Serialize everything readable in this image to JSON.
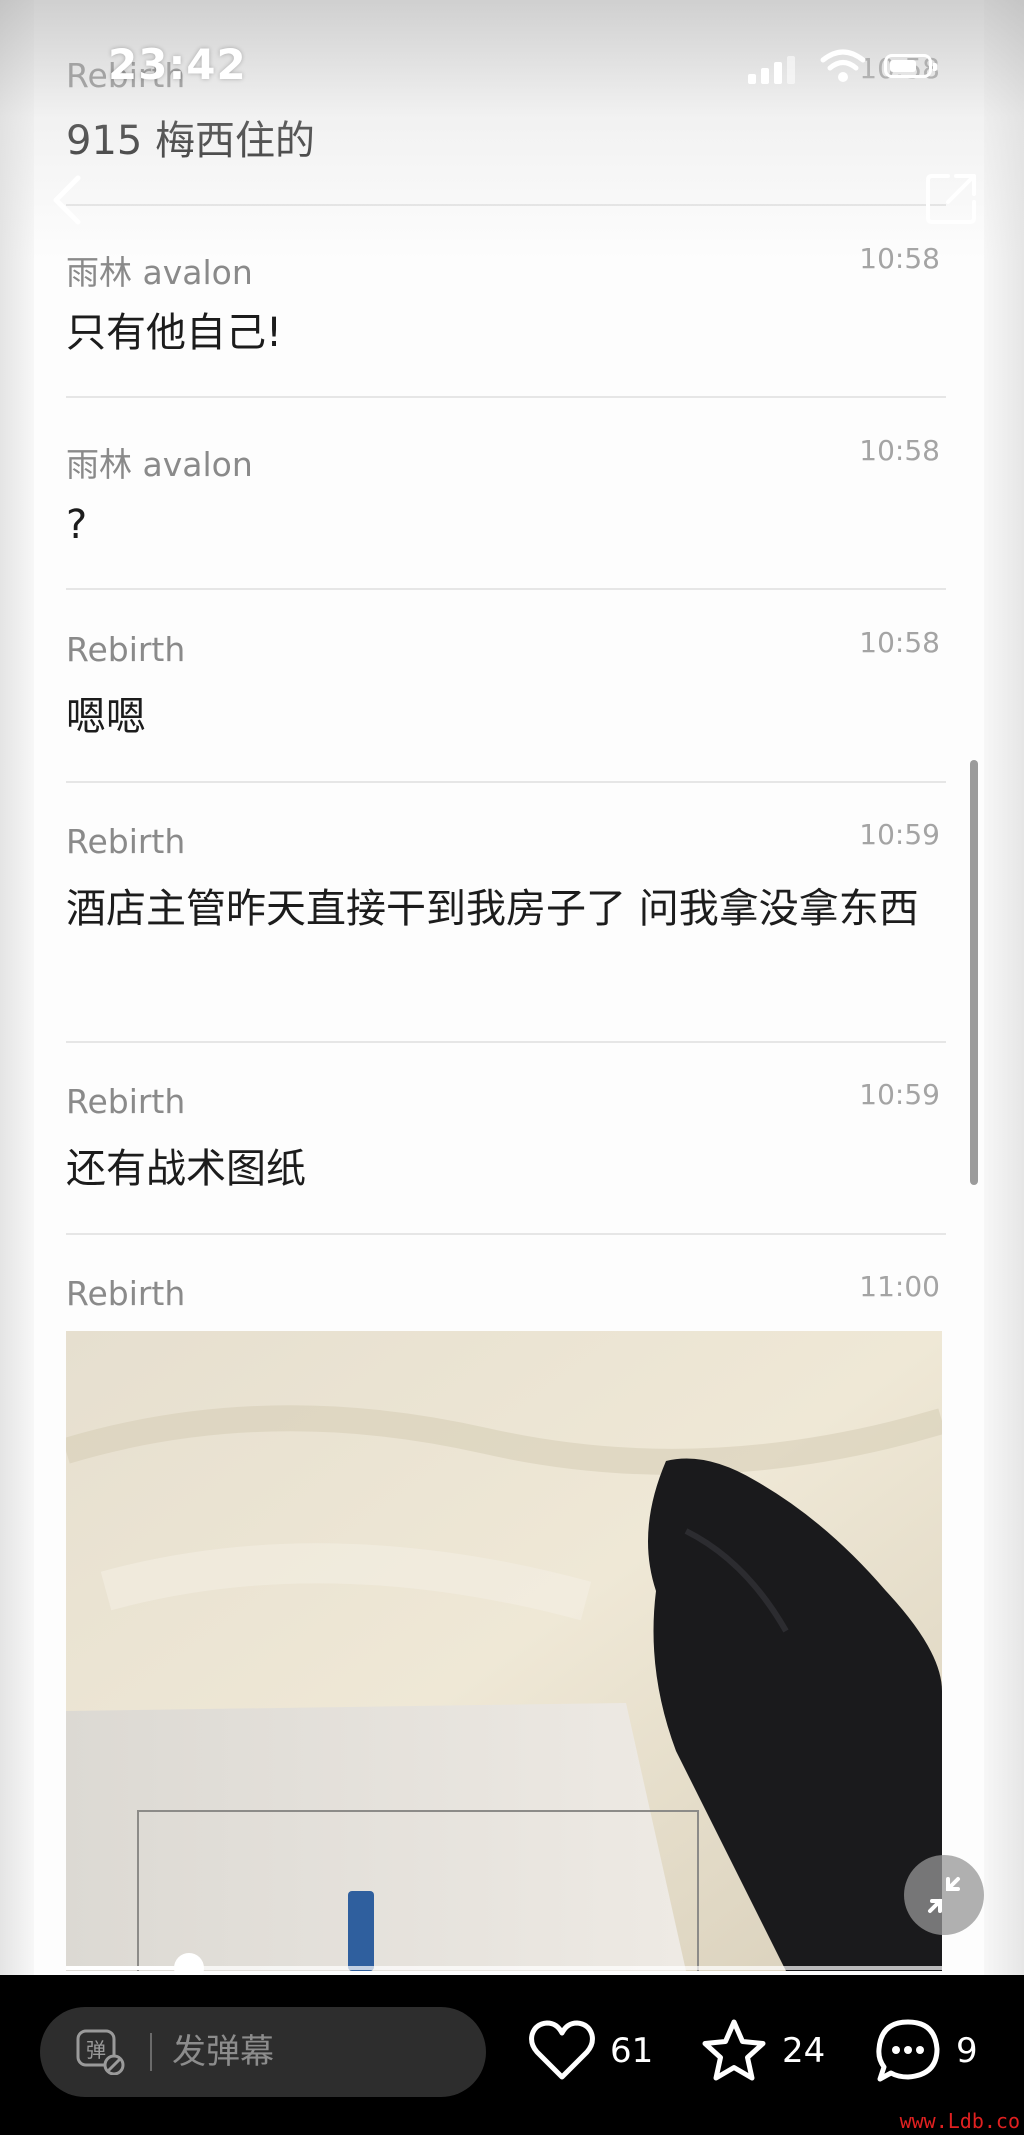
{
  "status_bar": {
    "time": "23:42"
  },
  "messages": [
    {
      "sender": "Rebirth",
      "time": "10:58",
      "text": "915 梅西住的"
    },
    {
      "sender": "雨林 avalon",
      "time": "10:58",
      "text": "只有他自己!"
    },
    {
      "sender": "雨林 avalon",
      "time": "10:58",
      "text": "?"
    },
    {
      "sender": "Rebirth",
      "time": "10:58",
      "text": "嗯嗯"
    },
    {
      "sender": "Rebirth",
      "time": "10:59",
      "text": "酒店主管昨天直接干到我房子了 问我拿没拿东西"
    },
    {
      "sender": "Rebirth",
      "time": "10:59",
      "text": "还有战术图纸"
    },
    {
      "sender": "Rebirth",
      "time": "11:00",
      "text": ""
    }
  ],
  "video": {
    "progress_fraction": 0.14
  },
  "bottom_bar": {
    "danmu_icon_label": "弹",
    "danmu_placeholder": "发弹幕",
    "likes": "61",
    "favorites": "24",
    "comments": "9"
  },
  "watermark": "www.Ldb.co",
  "icons": [
    "back-icon",
    "share-icon",
    "collapse-icon",
    "danmu-icon",
    "heart-icon",
    "star-icon",
    "comment-icon",
    "signal-icon",
    "wifi-icon",
    "battery-icon"
  ],
  "colors": {
    "bottom_bar_bg": "#000000",
    "danmu_box_bg": "#2d2d2d",
    "watermark": "#e02020"
  }
}
